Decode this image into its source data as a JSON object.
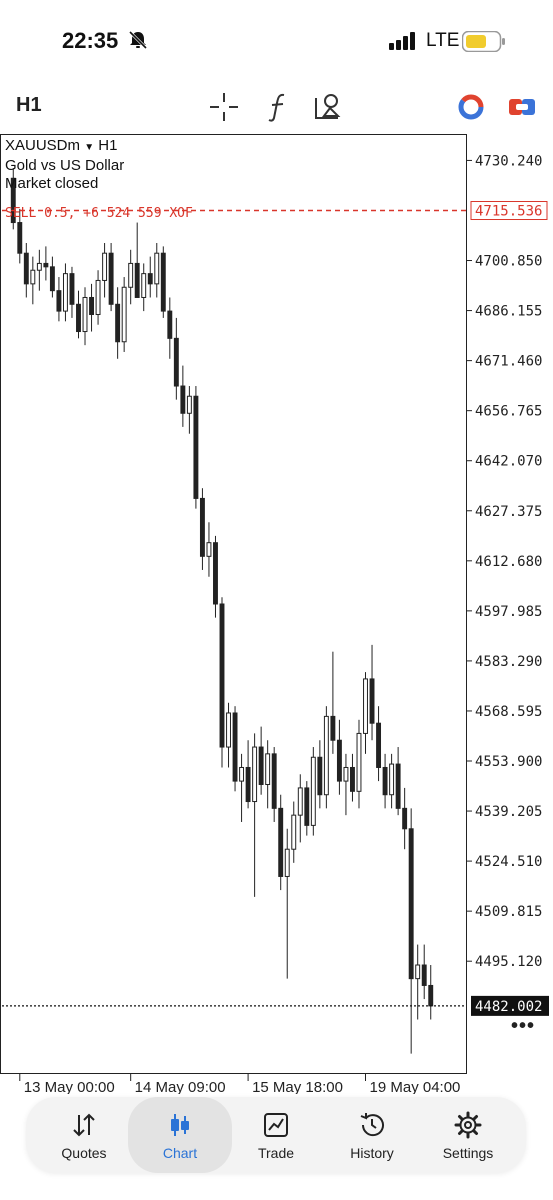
{
  "status": {
    "time": "22:35",
    "carrier": "LTE"
  },
  "toolbar": {
    "timeframe": "H1"
  },
  "chart": {
    "symbol": "XAUUSDm",
    "symbol_tf": "H1",
    "description": "Gold vs US Dollar",
    "market_status": "Market closed",
    "order_label": "SELL 0.5, +6 524 559 XOF",
    "order_price": "4715.536",
    "current_price": "4482.002",
    "more_label": "•••",
    "colors": {
      "order_line": "#d9362b",
      "order_text_blue": "#2a73d6",
      "bull": "#ffffff",
      "bear": "#222222"
    }
  },
  "chart_data": {
    "type": "candlestick",
    "y_ticks": [
      "4730.240",
      "4715.536",
      "4700.850",
      "4686.155",
      "4671.460",
      "4656.765",
      "4642.070",
      "4627.375",
      "4612.680",
      "4597.985",
      "4583.290",
      "4568.595",
      "4553.900",
      "4539.205",
      "4524.510",
      "4509.815",
      "4495.120",
      "4482.002"
    ],
    "x_ticks": [
      "13 May 00:00",
      "14 May 09:00",
      "15 May 18:00",
      "19 May 04:00"
    ],
    "ylim": [
      4462,
      4738
    ],
    "candles": [
      [
        4725,
        4728,
        4710,
        4712
      ],
      [
        4712,
        4716,
        4700,
        4703
      ],
      [
        4703,
        4706,
        4690,
        4694
      ],
      [
        4694,
        4702,
        4688,
        4698
      ],
      [
        4698,
        4704,
        4692,
        4700
      ],
      [
        4700,
        4705,
        4695,
        4699
      ],
      [
        4699,
        4702,
        4690,
        4692
      ],
      [
        4692,
        4696,
        4683,
        4686
      ],
      [
        4686,
        4700,
        4683,
        4697
      ],
      [
        4697,
        4699,
        4684,
        4688
      ],
      [
        4688,
        4692,
        4678,
        4680
      ],
      [
        4680,
        4693,
        4676,
        4690
      ],
      [
        4690,
        4694,
        4680,
        4685
      ],
      [
        4685,
        4698,
        4682,
        4695
      ],
      [
        4695,
        4706,
        4690,
        4703
      ],
      [
        4703,
        4706,
        4686,
        4688
      ],
      [
        4688,
        4693,
        4672,
        4677
      ],
      [
        4677,
        4696,
        4674,
        4693
      ],
      [
        4693,
        4704,
        4688,
        4700
      ],
      [
        4700,
        4712,
        4695,
        4690
      ],
      [
        4690,
        4700,
        4686,
        4697
      ],
      [
        4697,
        4702,
        4690,
        4694
      ],
      [
        4694,
        4706,
        4690,
        4703
      ],
      [
        4703,
        4705,
        4684,
        4686
      ],
      [
        4686,
        4690,
        4672,
        4678
      ],
      [
        4678,
        4684,
        4660,
        4664
      ],
      [
        4664,
        4670,
        4652,
        4656
      ],
      [
        4656,
        4664,
        4650,
        4661
      ],
      [
        4661,
        4664,
        4628,
        4631
      ],
      [
        4631,
        4634,
        4610,
        4614
      ],
      [
        4614,
        4624,
        4608,
        4618
      ],
      [
        4618,
        4620,
        4596,
        4600
      ],
      [
        4600,
        4602,
        4552,
        4558
      ],
      [
        4558,
        4571,
        4552,
        4568
      ],
      [
        4568,
        4570,
        4545,
        4548
      ],
      [
        4548,
        4556,
        4536,
        4552
      ],
      [
        4552,
        4560,
        4540,
        4542
      ],
      [
        4542,
        4562,
        4514,
        4558
      ],
      [
        4558,
        4564,
        4544,
        4547
      ],
      [
        4547,
        4560,
        4540,
        4556
      ],
      [
        4556,
        4558,
        4536,
        4540
      ],
      [
        4540,
        4544,
        4516,
        4520
      ],
      [
        4520,
        4534,
        4490,
        4528
      ],
      [
        4528,
        4542,
        4524,
        4538
      ],
      [
        4538,
        4550,
        4530,
        4546
      ],
      [
        4546,
        4548,
        4532,
        4535
      ],
      [
        4535,
        4558,
        4532,
        4555
      ],
      [
        4555,
        4560,
        4540,
        4544
      ],
      [
        4544,
        4570,
        4540,
        4567
      ],
      [
        4567,
        4586,
        4556,
        4560
      ],
      [
        4560,
        4566,
        4544,
        4548
      ],
      [
        4548,
        4556,
        4538,
        4552
      ],
      [
        4552,
        4556,
        4542,
        4545
      ],
      [
        4545,
        4566,
        4540,
        4562
      ],
      [
        4562,
        4580,
        4556,
        4578
      ],
      [
        4578,
        4588,
        4560,
        4565
      ],
      [
        4565,
        4570,
        4548,
        4552
      ],
      [
        4552,
        4556,
        4540,
        4544
      ],
      [
        4544,
        4556,
        4540,
        4553
      ],
      [
        4553,
        4558,
        4538,
        4540
      ],
      [
        4540,
        4546,
        4528,
        4534
      ],
      [
        4534,
        4540,
        4468,
        4490
      ],
      [
        4490,
        4500,
        4478,
        4494
      ],
      [
        4494,
        4500,
        4484,
        4488
      ],
      [
        4488,
        4494,
        4478,
        4482
      ]
    ]
  },
  "tabs": [
    {
      "label": "Quotes",
      "icon": "quotes-arrows-icon"
    },
    {
      "label": "Chart",
      "icon": "candlestick-icon",
      "active": true
    },
    {
      "label": "Trade",
      "icon": "trade-chart-icon"
    },
    {
      "label": "History",
      "icon": "history-clock-icon"
    },
    {
      "label": "Settings",
      "icon": "gear-icon"
    }
  ]
}
